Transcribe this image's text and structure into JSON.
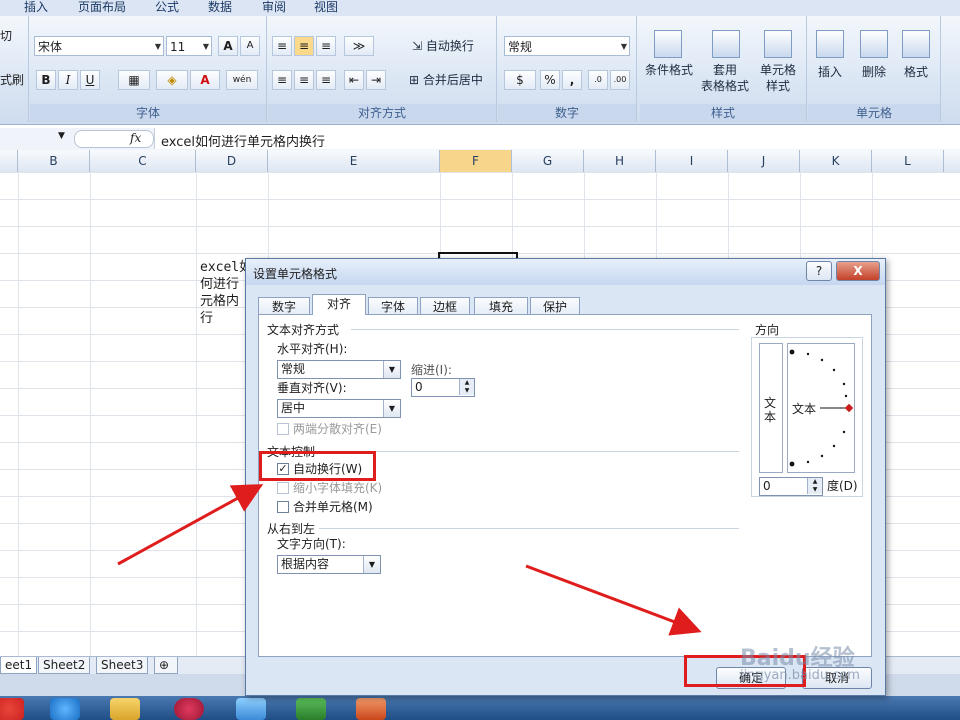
{
  "ribbon": {
    "tabs": [
      "插入",
      "页面布局",
      "公式",
      "数据",
      "审阅",
      "视图"
    ],
    "clipboard": {
      "cut": "切",
      "brush": "式刷"
    },
    "font": {
      "name": "宋体",
      "size": "11",
      "bold": "B",
      "italic": "I",
      "underline": "U",
      "grow": "A",
      "shrink": "A",
      "wen": "wén",
      "group_label": "字体"
    },
    "alignment": {
      "wrap_text": "自动换行",
      "merge_center": "合并后居中",
      "group_label": "对齐方式"
    },
    "number": {
      "format": "常规",
      "percent": "%",
      "comma": ",",
      "group_label": "数字"
    },
    "styles": {
      "conditional": "条件格式",
      "table_format_1": "套用",
      "table_format_2": "表格格式",
      "cell_style_1": "单元格",
      "cell_style_2": "样式",
      "group_label": "样式"
    },
    "cells": {
      "insert": "插入",
      "delete": "删除",
      "format": "格式",
      "group_label": "单元格"
    }
  },
  "formula_bar": {
    "fx": "fx",
    "content": "excel如何进行单元格内换行"
  },
  "columns": [
    "B",
    "C",
    "D",
    "E",
    "F",
    "G",
    "H",
    "I",
    "J",
    "K",
    "L"
  ],
  "cell_text": [
    "excel如",
    "何进行",
    "元格内",
    "行"
  ],
  "sheet_tabs": [
    "eet1",
    "Sheet2",
    "Sheet3"
  ],
  "dialog": {
    "title": "设置单元格格式",
    "help": "?",
    "close": "X",
    "tabs": [
      "数字",
      "对齐",
      "字体",
      "边框",
      "填充",
      "保护"
    ],
    "text_align_section": "文本对齐方式",
    "horizontal_label": "水平对齐(H):",
    "horizontal_value": "常规",
    "indent_label": "缩进(I):",
    "indent_value": "0",
    "vertical_label": "垂直对齐(V):",
    "vertical_value": "居中",
    "justify_distributed": "两端分散对齐(E)",
    "text_control_section": "文本控制",
    "wrap_text": "自动换行(W)",
    "wrap_checked": "✓",
    "shrink_to_fit": "缩小字体填充(K)",
    "merge_cells": "合并单元格(M)",
    "rtl_section": "从右到左",
    "text_direction_label": "文字方向(T):",
    "text_direction_value": "根据内容",
    "orientation_section": "方向",
    "orientation_vertical_text": "文本",
    "orientation_text": "文本",
    "degree_value": "0",
    "degree_label": "度(D)",
    "ok": "确定",
    "cancel": "取消"
  },
  "watermark": {
    "brand": "Baidu经验",
    "url": "jingyan.baidu.com"
  },
  "colors": {
    "highlight": "#e01d1d",
    "accent": "#2b5797"
  }
}
